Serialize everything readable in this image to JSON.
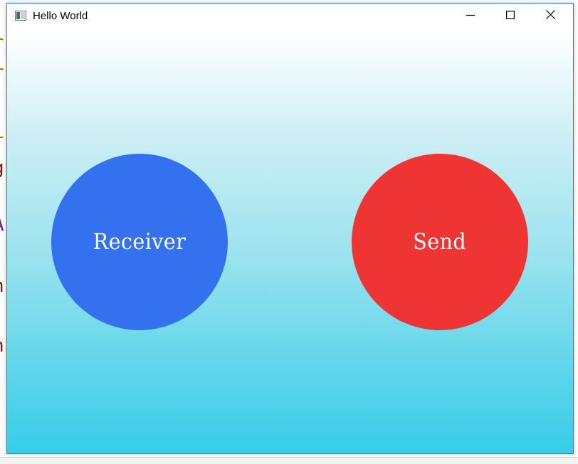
{
  "window": {
    "title": "Hello World",
    "border_color": "#2b7fd4"
  },
  "background_editor": {
    "lines": [
      {
        "text": "r",
        "color": "#8a8a00"
      },
      {
        "text": "r",
        "color": "#8a8a00"
      },
      {
        "text": "L",
        "color": "#8a8a00"
      },
      {
        "text": "g",
        "color": "#7a1a1a"
      },
      {
        "text": "A",
        "color": "#6a1a8a"
      },
      {
        "text": "n",
        "color": "#7a1a1a"
      },
      {
        "text": "n",
        "color": "#7a1a1a"
      }
    ]
  },
  "buttons": {
    "receiver": {
      "label": "Receiver",
      "color": "#3471ef"
    },
    "send": {
      "label": "Send",
      "color": "#ef3434"
    }
  },
  "controls": {
    "minimize_icon": "minimize-icon",
    "maximize_icon": "maximize-icon",
    "close_icon": "close-icon"
  },
  "colors": {
    "gradient_top": "#ffffff",
    "gradient_bottom": "#36cde9"
  }
}
